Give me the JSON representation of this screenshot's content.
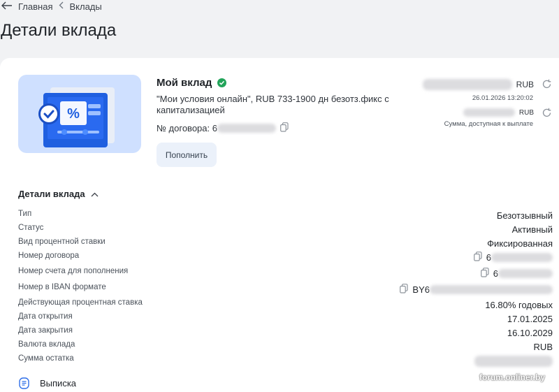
{
  "breadcrumb": {
    "home": "Главная",
    "current": "Вклады"
  },
  "page_title": "Детали вклада",
  "deposit": {
    "name": "Мой вклад",
    "description": "\"Мои условия онлайн\", RUB 733-1900 дн безотз.фикс с капитализацией",
    "contract_label": "№ договора: 6",
    "topup_label": "Пополнить"
  },
  "balance": {
    "currency1": "RUB",
    "timestamp": "26.01.2026 13:20:02",
    "currency2": "RUB",
    "available_note": "Сумма, доступная к выплате"
  },
  "details": {
    "heading": "Детали вклада",
    "rows": [
      {
        "label": "Тип",
        "value": "Безотзывный"
      },
      {
        "label": "Статус",
        "value": "Активный"
      },
      {
        "label": "Вид процентной ставки",
        "value": "Фиксированная"
      },
      {
        "label": "Номер договора",
        "value": "6"
      },
      {
        "label": "Номер счета для пополнения",
        "value": "6"
      },
      {
        "label": "Номер в IBAN формате",
        "value": "BY6"
      },
      {
        "label": "Действующая процентная ставка",
        "value": "16.80% годовых"
      },
      {
        "label": "Дата открытия",
        "value": "17.01.2025"
      },
      {
        "label": "Дата закрытия",
        "value": "16.10.2029"
      },
      {
        "label": "Валюта вклада",
        "value": "RUB"
      },
      {
        "label": "Сумма остатка",
        "value": ""
      }
    ]
  },
  "statement_label": "Выписка",
  "watermark": "forum.onliner.by",
  "icons": {
    "back": "arrow-left-icon",
    "separator": "chevron-left-icon",
    "verified": "check-circle-icon",
    "copy": "copy-icon",
    "refresh": "refresh-icon",
    "collapse": "chevron-up-icon",
    "statement": "document-icon"
  },
  "colors": {
    "accent": "#22a45a",
    "button_bg": "#ebf1fa",
    "illustration_bg": "#cfe0ff"
  }
}
